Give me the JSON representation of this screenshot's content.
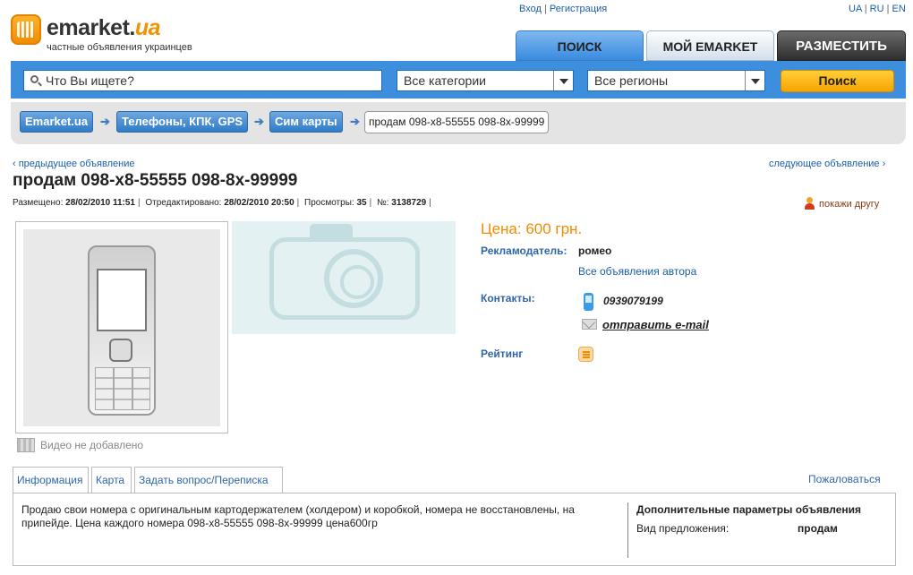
{
  "header": {
    "logo_main": "emarket.",
    "logo_ua": "ua",
    "logo_sub": "частные объявления украинцев",
    "auth": {
      "login": "Вход",
      "register": "Регистрация"
    },
    "langs": [
      "UA",
      "RU",
      "EN"
    ],
    "tabs": {
      "search": "ПОИСК",
      "my": "МОЙ EMARKET",
      "post": "РАЗМЕСТИТЬ"
    }
  },
  "search": {
    "placeholder": "Что Вы ищете?",
    "category": "Все категории",
    "region": "Все регионы",
    "button": "Поиск"
  },
  "breadcrumbs": {
    "items": [
      "Emarket.ua",
      "Телефоны, КПК, GPS",
      "Сим карты"
    ],
    "current": "продам 098-x8-55555 098-8x-99999"
  },
  "nav": {
    "prev": "‹ предыдущее объявление",
    "next": "следующее объявление ›"
  },
  "ad": {
    "title": "продам 098-x8-55555 098-8x-99999",
    "meta": {
      "posted_label": "Размещено:",
      "posted": "28/02/2010 11:51",
      "edited_label": "Отредактировано:",
      "edited": "28/02/2010 20:50",
      "views_label": "Просмотры:",
      "views": "35",
      "num_label": "№:",
      "num": "3138729"
    },
    "share": "покажи другу",
    "video": "Видео не добавлено",
    "price": "Цена: 600 грн.",
    "advertiser_label": "Рекламодатель:",
    "advertiser": "ромео",
    "all_ads": "Все объявления автора",
    "contacts_label": "Контакты:",
    "phone": "0939079199",
    "email_link": "отправить e-mail",
    "rating_label": "Рейтинг"
  },
  "info_tabs": [
    "Информация",
    "Карта",
    "Задать вопрос/Переписка"
  ],
  "complain": "Пожаловаться",
  "description": "Продаю свои номера с оригинальным картодержателем (холдером) и коробкой, номера не восстановлены, на припейде. Цена каждого номера 098-x8-55555 098-8x-99999 цена600гр",
  "extra": {
    "title": "Дополнительные параметры объявления",
    "key": "Вид предложения:",
    "value": "продам"
  },
  "colors": {
    "brand_blue": "#3d8fdd",
    "accent_orange": "#f28a00",
    "link_blue": "#1a5fa8"
  }
}
